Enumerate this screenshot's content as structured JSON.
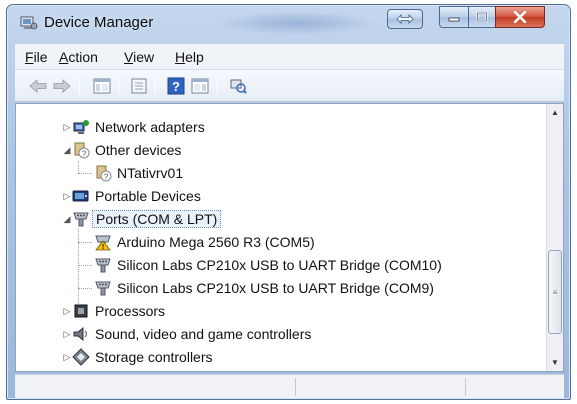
{
  "window": {
    "title": "Device Manager"
  },
  "menu": [
    {
      "accel": "F",
      "rest": "ile"
    },
    {
      "accel": "A",
      "rest": "ction"
    },
    {
      "accel": "V",
      "rest": "iew"
    },
    {
      "accel": "H",
      "rest": "elp"
    }
  ],
  "toolbar": {
    "icons": [
      "back-arrow-icon",
      "forward-arrow-icon",
      "show-hide-console-tree-icon",
      "properties-icon",
      "help-icon",
      "action-pane-icon",
      "scan-hardware-icon"
    ]
  },
  "tree": {
    "items": [
      {
        "label": "Network adapters",
        "icon": "network-adapter-icon",
        "expander": "collapsed"
      },
      {
        "label": "Other devices",
        "icon": "other-devices-icon",
        "expander": "expanded"
      },
      {
        "label": "NTativrv01",
        "icon": "unknown-device-icon"
      },
      {
        "label": "Portable Devices",
        "icon": "portable-device-icon",
        "expander": "collapsed"
      },
      {
        "label": "Ports (COM & LPT)",
        "icon": "port-icon",
        "expander": "expanded",
        "selected": true
      },
      {
        "label": "Arduino Mega 2560 R3 (COM5)",
        "icon": "port-warning-icon"
      },
      {
        "label": "Silicon Labs CP210x USB to UART Bridge (COM10)",
        "icon": "port-icon"
      },
      {
        "label": "Silicon Labs CP210x USB to UART Bridge (COM9)",
        "icon": "port-icon"
      },
      {
        "label": "Processors",
        "icon": "processor-icon",
        "expander": "collapsed"
      },
      {
        "label": "Sound, video and game controllers",
        "icon": "sound-icon",
        "expander": "collapsed"
      },
      {
        "label": "Storage controllers",
        "icon": "storage-controller-icon",
        "expander": "collapsed"
      }
    ]
  },
  "colors": {
    "title_bar": "#a9c3e3",
    "close_button": "#c23b22",
    "selection_border": "#6b8db8",
    "warning": "#f2c200"
  }
}
